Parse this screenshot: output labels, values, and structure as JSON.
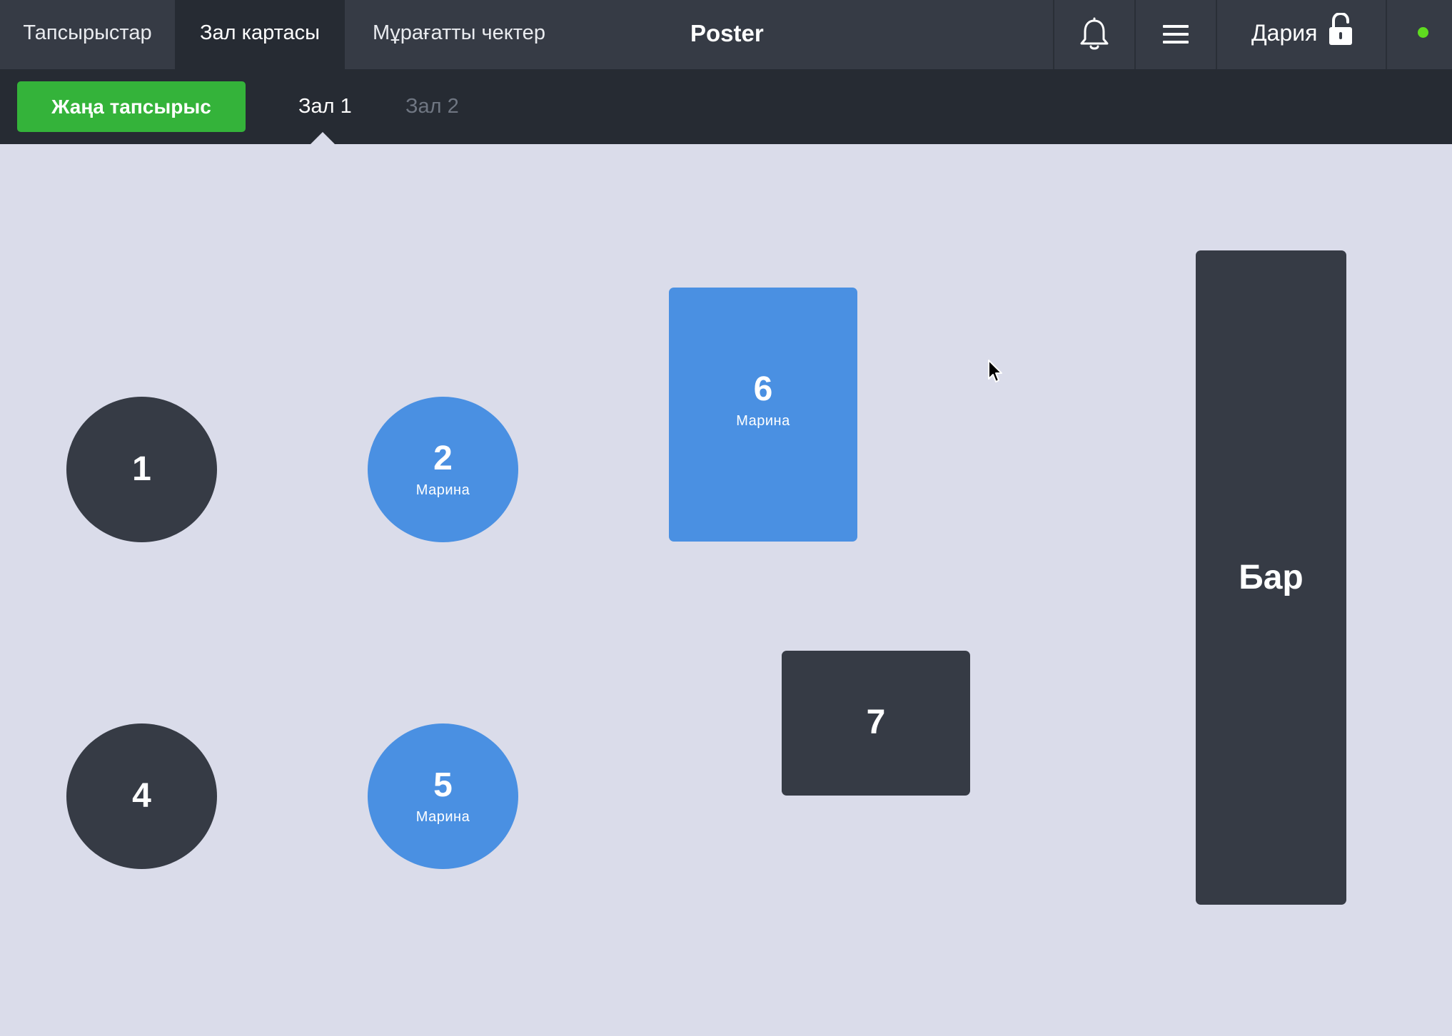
{
  "colors": {
    "topbar_bg": "#363b45",
    "active_tab_bg": "#262b33",
    "subbar_bg": "#262b33",
    "floor_bg": "#dadcea",
    "green": "#34b33a",
    "table_free": "#363b45",
    "table_busy": "#4a90e2",
    "online": "#5fdc1f"
  },
  "nav": {
    "tabs": [
      {
        "label": "Тапсырыстар",
        "active": false
      },
      {
        "label": "Зал картасы",
        "active": true
      },
      {
        "label": "Мұрағатты чектер",
        "active": false
      }
    ],
    "brand": "Poster",
    "icons": [
      "bell-icon",
      "menu-icon",
      "lock-open-icon"
    ],
    "user": {
      "name": "Дария"
    }
  },
  "subnav": {
    "new_order_label": "Жаңа тапсырыс",
    "halls": [
      {
        "label": "Зал 1",
        "active": true
      },
      {
        "label": "Зал 2",
        "active": false
      }
    ]
  },
  "tables": [
    {
      "number": "1",
      "shape": "round",
      "status": "free",
      "waiter": ""
    },
    {
      "number": "2",
      "shape": "round",
      "status": "busy",
      "waiter": "Марина"
    },
    {
      "number": "4",
      "shape": "round",
      "status": "free",
      "waiter": ""
    },
    {
      "number": "5",
      "shape": "round",
      "status": "busy",
      "waiter": "Марина"
    },
    {
      "number": "6",
      "shape": "rect",
      "status": "busy",
      "waiter": "Марина"
    },
    {
      "number": "7",
      "shape": "rect",
      "status": "free",
      "waiter": ""
    }
  ],
  "bar": {
    "label": "Бар"
  }
}
